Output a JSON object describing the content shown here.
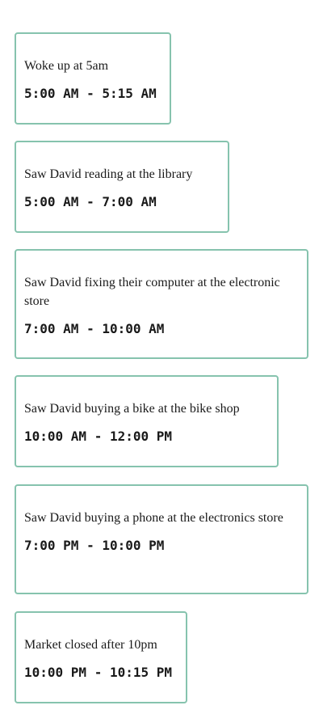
{
  "events": [
    {
      "description": "Woke up at 5am",
      "time": "5:00 AM - 5:15 AM"
    },
    {
      "description": "Saw David reading at the library",
      "time": "5:00 AM - 7:00 AM"
    },
    {
      "description": "Saw David fixing their computer at the electronic store",
      "time": "7:00 AM - 10:00 AM"
    },
    {
      "description": "Saw David buying a bike at the bike shop",
      "time": "10:00 AM - 12:00 PM"
    },
    {
      "description": "Saw David buying a phone at the electronics store",
      "time": "7:00 PM - 10:00 PM"
    },
    {
      "description": "Market closed after 10pm",
      "time": "10:00 PM - 10:15 PM"
    }
  ],
  "colors": {
    "card_border": "#86c3ae",
    "text": "#1a1a1a",
    "background": "#ffffff"
  }
}
